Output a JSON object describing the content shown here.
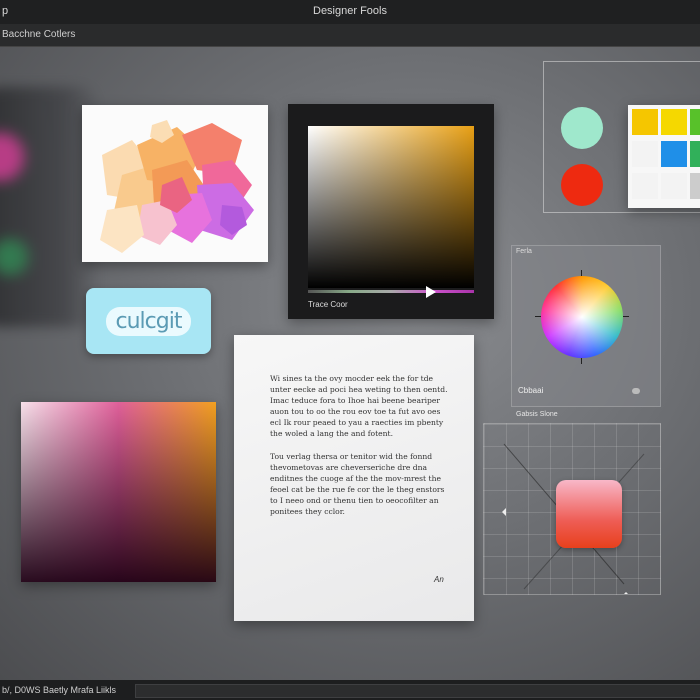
{
  "titlebar": {
    "app": "p",
    "title": "Designer Fools"
  },
  "toolbar": {
    "label": "Bacchne Cotlers"
  },
  "picker": {
    "label": "Trace Coor"
  },
  "logo": {
    "text": "culcgit"
  },
  "document": {
    "paragraph1": "Wi sines ta the ovy mocder eek the for tde unter eecke ad poci hea weting to then oentd. Imac teduce fora to Ihoe hai beene beariper auon tou to oo the rou eov toe ta fut avo oes ecl Ik rour peaed to yau a raecties im pbenty the woled a lang the and fotent.",
    "paragraph2": "Tou verlag thersa or tenitor wid the fonnd thevometovas are cheverseriche dre dna enditnes the cuoge af the the mov-mrest the feoel cat be the rue fe cor the le theg enstors to I neeo ond or thenu tien to oeocofilter an ponitees they cclor.",
    "signature": "An"
  },
  "swatches": {
    "mint": "#9fe8cc",
    "red": "#ee2a10"
  },
  "palette": {
    "colors": [
      "#f5c600",
      "#f5d800",
      "#58c12a",
      "#f3f3f3",
      "#1f8fe8",
      "#31b05a",
      "#f3f3f3",
      "#f3f3f3",
      "#cccccc"
    ]
  },
  "wheel_panel": {
    "title": "Ferla",
    "label": "Cbbaai"
  },
  "grid_panel": {
    "title": "Gabsis Slone"
  },
  "statusbar": {
    "text": "b/, D0WS Baetly Mrafa Liikls"
  }
}
